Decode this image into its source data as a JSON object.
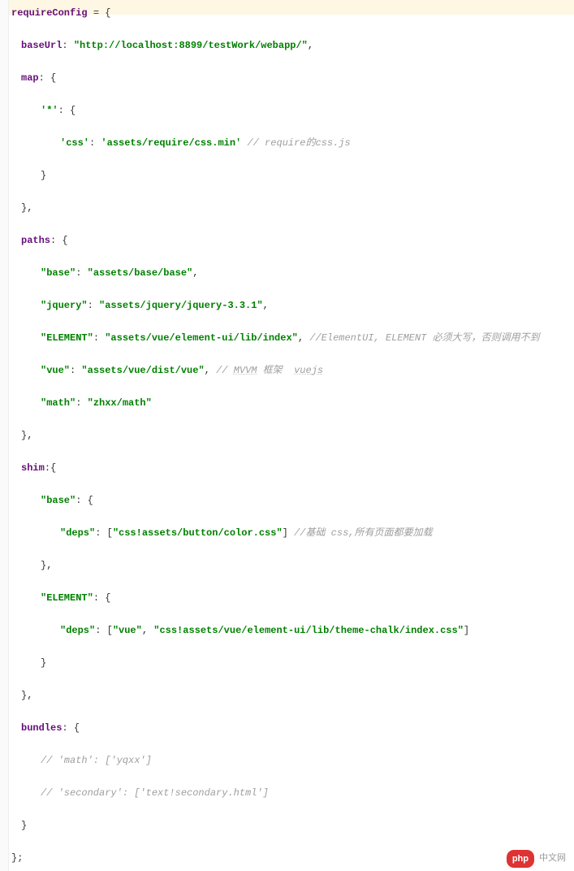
{
  "code": {
    "var": "requireConfig",
    "baseUrlKey": "baseUrl",
    "baseUrlVal": "\"http://localhost:8899/testWork/webapp/\"",
    "map": {
      "key": "map",
      "starKey": "'*'",
      "cssKey": "'css'",
      "cssVal": "'assets/require/css.min'",
      "cssComment": "// require的css.js"
    },
    "paths": {
      "key": "paths",
      "baseKey": "\"base\"",
      "baseVal": "\"assets/base/base\"",
      "jqueryKey": "\"jquery\"",
      "jqueryVal": "\"assets/jquery/jquery-3.3.1\"",
      "elementKey": "\"ELEMENT\"",
      "elementVal": "\"assets/vue/element-ui/lib/index\"",
      "elementComment": "//ElementUI, ELEMENT 必须大写，否则调用不到",
      "vueKey": "\"vue\"",
      "vueVal": "\"assets/vue/dist/vue\"",
      "vueComment1": "// ",
      "vueCommentUnderlined": "MVVM",
      "vueComment2": " 框架  ",
      "vueCommentUnderlined2": "vuejs",
      "mathKey": "\"math\"",
      "mathVal": "\"zhxx/math\""
    },
    "shim": {
      "key": "shim",
      "baseKey": "\"base\"",
      "depsKey": "\"deps\"",
      "baseDepVal": "\"css!assets/button/color.css\"",
      "baseComment": "//基础 css,所有页面都要加载",
      "elementKey": "\"ELEMENT\"",
      "elementDep1": "\"vue\"",
      "elementDep2": "\"css!assets/vue/element-ui/lib/theme-chalk/index.css\""
    },
    "bundles": {
      "key": "bundles",
      "comment1": "// 'math': ['yqxx']",
      "comment2": "// 'secondary': ['text!secondary.html']"
    }
  },
  "watermark": {
    "pill": "php",
    "text": "中文网"
  }
}
